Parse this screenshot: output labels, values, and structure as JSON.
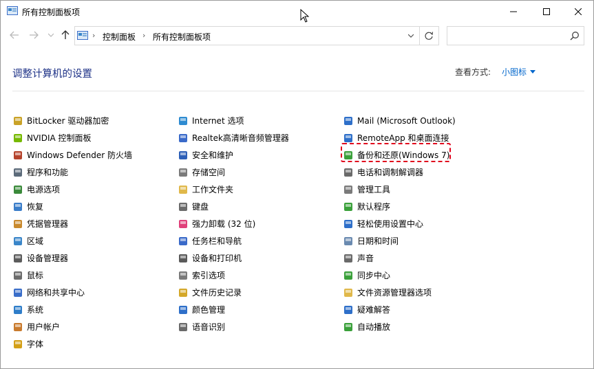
{
  "window": {
    "title": "所有控制面板项",
    "controls": {
      "minimize": "—",
      "maximize": "☐",
      "close": "✕"
    }
  },
  "address": {
    "crumbs": [
      "控制面板",
      "所有控制面板项"
    ],
    "separator": "›",
    "search_placeholder": ""
  },
  "header": {
    "title": "调整计算机的设置",
    "view_by_label": "查看方式:",
    "view_by_value": "小图标"
  },
  "items": {
    "col1": [
      {
        "label": "BitLocker 驱动器加密",
        "icon": "bitlocker-icon",
        "color": "#c9a227"
      },
      {
        "label": "NVIDIA 控制面板",
        "icon": "nvidia-icon",
        "color": "#76b900"
      },
      {
        "label": "Windows Defender 防火墙",
        "icon": "firewall-icon",
        "color": "#b5432c"
      },
      {
        "label": "程序和功能",
        "icon": "programs-icon",
        "color": "#5c6b7a"
      },
      {
        "label": "电源选项",
        "icon": "power-icon",
        "color": "#3a8a3a"
      },
      {
        "label": "恢复",
        "icon": "recovery-icon",
        "color": "#3a7dc9"
      },
      {
        "label": "凭据管理器",
        "icon": "credential-icon",
        "color": "#c98a2e"
      },
      {
        "label": "区域",
        "icon": "region-icon",
        "color": "#3a86c9"
      },
      {
        "label": "设备管理器",
        "icon": "device-manager-icon",
        "color": "#5c5c5c"
      },
      {
        "label": "鼠标",
        "icon": "mouse-icon",
        "color": "#6c6c6c"
      },
      {
        "label": "网络和共享中心",
        "icon": "network-icon",
        "color": "#3a6ec9"
      },
      {
        "label": "系统",
        "icon": "system-icon",
        "color": "#2e7dc9"
      },
      {
        "label": "用户帐户",
        "icon": "user-accounts-icon",
        "color": "#c97b2e"
      },
      {
        "label": "字体",
        "icon": "fonts-icon",
        "color": "#d4a017"
      }
    ],
    "col2": [
      {
        "label": "Internet 选项",
        "icon": "internet-icon",
        "color": "#2e8bd1"
      },
      {
        "label": "Realtek高清晰音频管理器",
        "icon": "realtek-icon",
        "color": "#3a6ac9"
      },
      {
        "label": "安全和维护",
        "icon": "flag-icon",
        "color": "#2d5fb8"
      },
      {
        "label": "存储空间",
        "icon": "storage-icon",
        "color": "#7a7a7a"
      },
      {
        "label": "工作文件夹",
        "icon": "work-folders-icon",
        "color": "#e0b84a"
      },
      {
        "label": "键盘",
        "icon": "keyboard-icon",
        "color": "#6a6a6a"
      },
      {
        "label": "强力卸载 (32 位)",
        "icon": "uninstall-icon",
        "color": "#e0407a"
      },
      {
        "label": "任务栏和导航",
        "icon": "taskbar-icon",
        "color": "#3a6ac9"
      },
      {
        "label": "设备和打印机",
        "icon": "printer-icon",
        "color": "#5a5a5a"
      },
      {
        "label": "索引选项",
        "icon": "indexing-icon",
        "color": "#7a7a7a"
      },
      {
        "label": "文件历史记录",
        "icon": "file-history-icon",
        "color": "#d4a82a"
      },
      {
        "label": "颜色管理",
        "icon": "color-management-icon",
        "color": "#2e6fc9"
      },
      {
        "label": "语音识别",
        "icon": "microphone-icon",
        "color": "#6a6a6a"
      }
    ],
    "col3": [
      {
        "label": "Mail (Microsoft Outlook)",
        "icon": "mail-icon",
        "color": "#2e6fc9"
      },
      {
        "label": "RemoteApp 和桌面连接",
        "icon": "remoteapp-icon",
        "color": "#2e6fc9"
      },
      {
        "label": "备份和还原(Windows 7)",
        "icon": "backup-icon",
        "color": "#3aa03a"
      },
      {
        "label": "电话和调制解调器",
        "icon": "phone-icon",
        "color": "#6a6a6a"
      },
      {
        "label": "管理工具",
        "icon": "admin-tools-icon",
        "color": "#7a7a7a"
      },
      {
        "label": "默认程序",
        "icon": "default-programs-icon",
        "color": "#3aa03a"
      },
      {
        "label": "轻松使用设置中心",
        "icon": "ease-of-access-icon",
        "color": "#2e6fc9"
      },
      {
        "label": "日期和时间",
        "icon": "date-time-icon",
        "color": "#6a8ab0"
      },
      {
        "label": "声音",
        "icon": "sound-icon",
        "color": "#6a6a6a"
      },
      {
        "label": "同步中心",
        "icon": "sync-icon",
        "color": "#3aa03a"
      },
      {
        "label": "文件资源管理器选项",
        "icon": "explorer-options-icon",
        "color": "#e0b84a"
      },
      {
        "label": "疑难解答",
        "icon": "troubleshoot-icon",
        "color": "#2e6fc9"
      },
      {
        "label": "自动播放",
        "icon": "autoplay-icon",
        "color": "#3aa03a"
      }
    ]
  }
}
